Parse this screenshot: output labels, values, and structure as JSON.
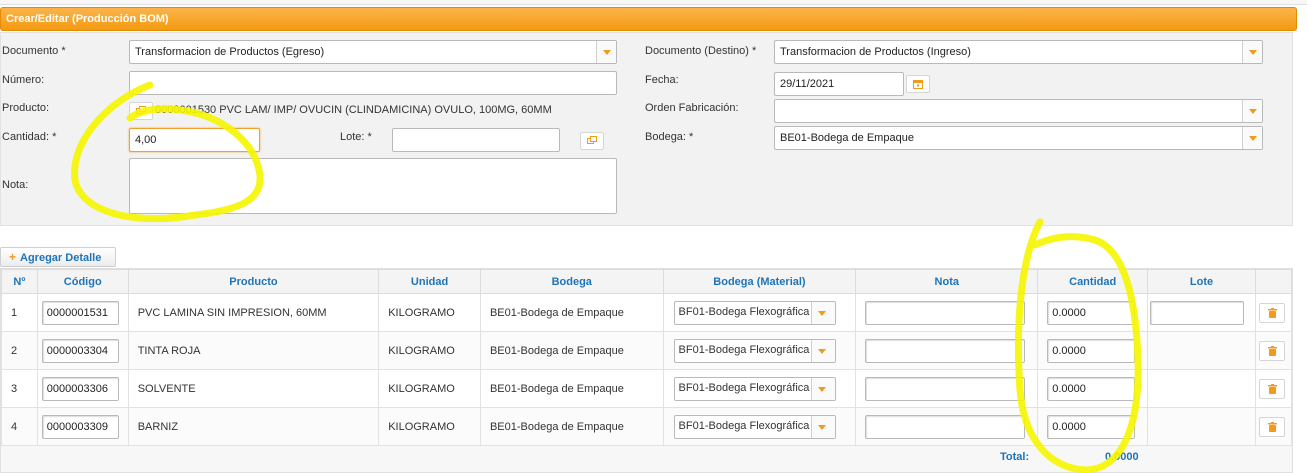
{
  "header": {
    "title": "Crear/Editar (Producción BOM)"
  },
  "form": {
    "documento": {
      "label": "Documento",
      "req": "*",
      "value": "Transformacion de Productos (Egreso)"
    },
    "numero": {
      "label": "Número:",
      "value": ""
    },
    "producto": {
      "label": "Producto:",
      "value": "0000001530 PVC LAM/ IMP/ OVUCIN (CLINDAMICINA) OVULO, 100MG, 60MM"
    },
    "cantidad": {
      "label": "Cantidad:",
      "req": "*",
      "value": "4,00"
    },
    "lote": {
      "label": "Lote:",
      "req": "*",
      "value": ""
    },
    "nota": {
      "label": "Nota:",
      "value": ""
    },
    "documento_destino": {
      "label": "Documento (Destino)",
      "req": "*",
      "value": "Transformacion de Productos (Ingreso)"
    },
    "fecha": {
      "label": "Fecha:",
      "value": "29/11/2021"
    },
    "orden_fabricacion": {
      "label": "Orden Fabricación:",
      "value": ""
    },
    "bodega": {
      "label": "Bodega:",
      "req": "*",
      "value": "BE01-Bodega de Empaque"
    }
  },
  "add_detail_label": "Agregar Detalle",
  "table": {
    "columns": [
      "Nº",
      "Código",
      "Producto",
      "Unidad",
      "Bodega",
      "Bodega (Material)",
      "Nota",
      "Cantidad",
      "Lote",
      ""
    ],
    "rows": [
      {
        "n": "1",
        "codigo": "0000001531",
        "producto": "PVC LAMINA SIN IMPRESION, 60MM",
        "unidad": "KILOGRAMO",
        "bodega": "BE01-Bodega de Empaque",
        "bodega_material": "BF01-Bodega Flexográfica",
        "nota": "",
        "cantidad": "0.0000",
        "lote": ""
      },
      {
        "n": "2",
        "codigo": "0000003304",
        "producto": "TINTA ROJA",
        "unidad": "KILOGRAMO",
        "bodega": "BE01-Bodega de Empaque",
        "bodega_material": "BF01-Bodega Flexográfica",
        "nota": "",
        "cantidad": "0.0000"
      },
      {
        "n": "3",
        "codigo": "0000003306",
        "producto": "SOLVENTE",
        "unidad": "KILOGRAMO",
        "bodega": "BE01-Bodega de Empaque",
        "bodega_material": "BF01-Bodega Flexográfica",
        "nota": "",
        "cantidad": "0.0000"
      },
      {
        "n": "4",
        "codigo": "0000003309",
        "producto": "BARNIZ",
        "unidad": "KILOGRAMO",
        "bodega": "BE01-Bodega de Empaque",
        "bodega_material": "BF01-Bodega Flexográfica",
        "nota": "",
        "cantidad": "0.0000"
      }
    ],
    "total_label": "Total:",
    "total_value": "0.0000"
  },
  "colors": {
    "accent": "#f39a10",
    "link": "#1f74b8",
    "highlight": "#f5f500"
  },
  "icons": {
    "lookup": "lookup-icon",
    "calendar": "calendar-icon",
    "trash": "trash-icon",
    "dropdown": "chevron-down-icon",
    "plus": "plus-icon"
  }
}
